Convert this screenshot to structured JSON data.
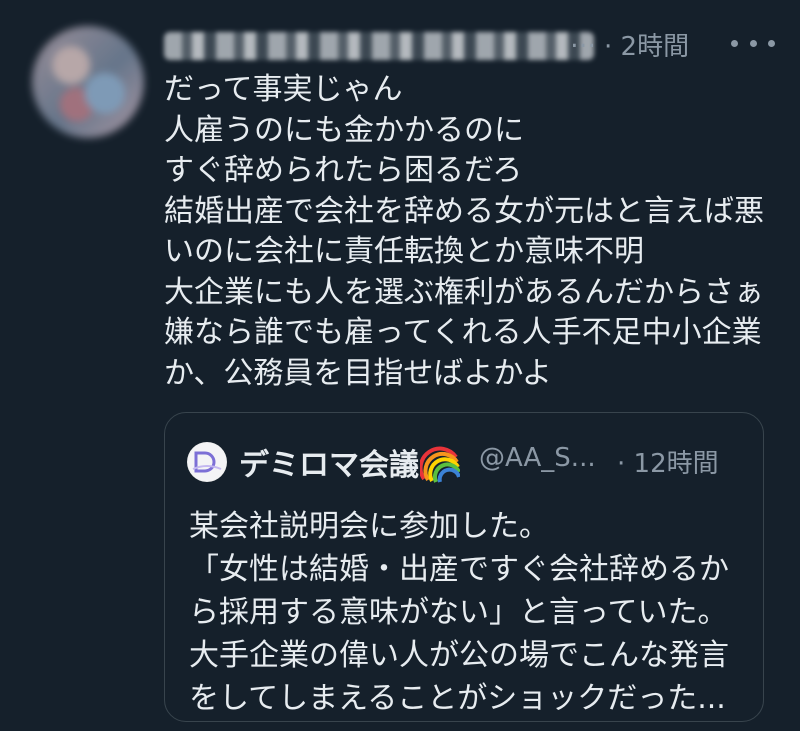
{
  "tweet": {
    "username_obscured": true,
    "handle_suffix": "…",
    "time": "· 2時間",
    "more_icon": "ellipsis-icon",
    "lines": [
      "だって事実じゃん",
      "人雇うのにも金かかるのに",
      "すぐ辞められたら困るだろ",
      "結婚出産で会社を辞める女が元はと言えば悪",
      "いのに会社に責任転換とか意味不明",
      "大企業にも人を選ぶ権利があるんだからさぁ",
      "嫌なら誰でも雇ってくれる人手不足中小企業",
      "か、公務員を目指せばよかよ"
    ]
  },
  "quote": {
    "display_name": "デミロマ会議",
    "emoji_icon": "rainbow-icon",
    "handle": "@AA_S...",
    "time": "· 12時間",
    "lines": [
      "某会社説明会に参加した。",
      "「女性は結婚・出産ですぐ会社辞めるか",
      "ら採用する意味がない」と言っていた。",
      "大手企業の偉い人が公の場でこんな発言",
      "をしてしまえることがショックだった..."
    ]
  },
  "colors": {
    "background": "#15202b",
    "text": "#e7ecf0",
    "secondary_text": "#8b98a5",
    "border": "#38444d"
  }
}
